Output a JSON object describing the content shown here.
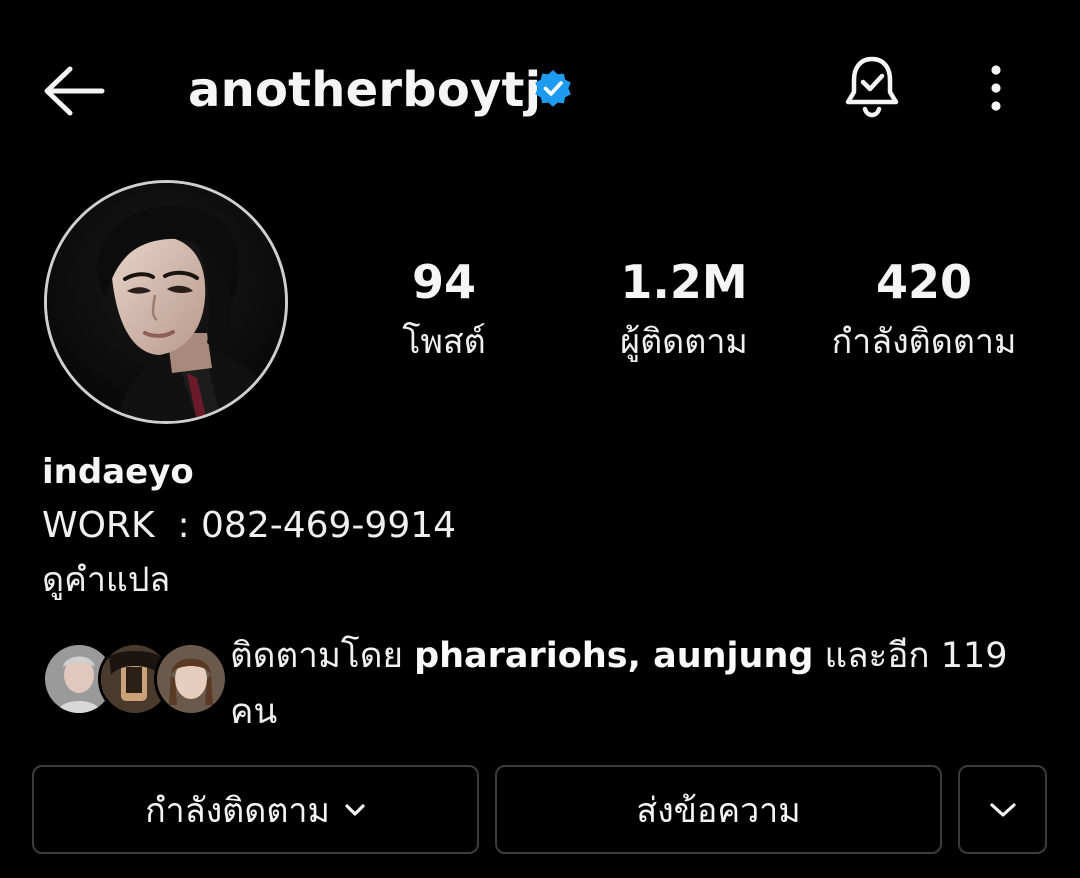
{
  "header": {
    "username": "anotherboytj",
    "back_icon": "arrow-left-icon",
    "verified_icon": "verified-badge-icon",
    "notification_icon": "bell-check-icon",
    "menu_icon": "more-vertical-icon"
  },
  "stats": [
    {
      "value": "94",
      "label": "โพสต์"
    },
    {
      "value": "1.2M",
      "label": "ผู้ติดตาม"
    },
    {
      "value": "420",
      "label": "กำลังติดตาม"
    }
  ],
  "bio": {
    "name": "indaeyo",
    "line": "WORK  : 082-469-9914",
    "see_translation": "ดูคำแปล"
  },
  "followed_by": {
    "prefix": "ติดตามโดย ",
    "users": "pharariohs, aunjung",
    "suffix": " และอีก 119 คน"
  },
  "buttons": {
    "following_label": "กำลังติดตาม",
    "message_label": "ส่งข้อความ",
    "more_icon": "chevron-down-icon"
  },
  "colors": {
    "background": "#000000",
    "text": "#f5f5f5",
    "verified": "#1d9bf0",
    "button_border": "#3c3c3c"
  }
}
